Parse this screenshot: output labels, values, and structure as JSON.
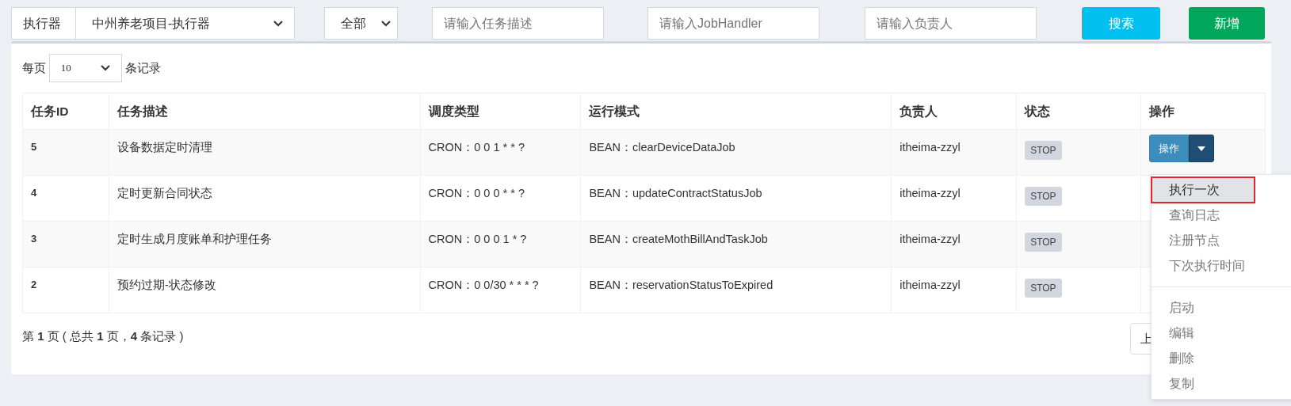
{
  "filters": {
    "executor_label": "执行器",
    "executor_value": "中州养老项目-执行器",
    "status_value": "全部",
    "desc_placeholder": "请输入任务描述",
    "handler_placeholder": "请输入JobHandler",
    "author_placeholder": "请输入负责人",
    "search_button": "搜索",
    "add_button": "新增"
  },
  "page_size": {
    "before": "每页",
    "value": "10",
    "after": "条记录"
  },
  "table": {
    "columns": [
      "任务ID",
      "任务描述",
      "调度类型",
      "运行模式",
      "负责人",
      "状态",
      "操作"
    ],
    "rows": [
      {
        "id": "5",
        "desc": "设备数据定时清理",
        "schedule": "CRON：0 0 1 * * ?",
        "mode": "BEAN：clearDeviceDataJob",
        "author": "itheima-zzyl",
        "status": "STOP",
        "action": "操作"
      },
      {
        "id": "4",
        "desc": "定时更新合同状态",
        "schedule": "CRON：0 0 0 * * ?",
        "mode": "BEAN：updateContractStatusJob",
        "author": "itheima-zzyl",
        "status": "STOP"
      },
      {
        "id": "3",
        "desc": "定时生成月度账单和护理任务",
        "schedule": "CRON：0 0 0 1 * ?",
        "mode": "BEAN：createMothBillAndTaskJob",
        "author": "itheima-zzyl",
        "status": "STOP"
      },
      {
        "id": "2",
        "desc": "预约过期-状态修改",
        "schedule": "CRON：0 0/30 * * * ?",
        "mode": "BEAN：reservationStatusToExpired",
        "author": "itheima-zzyl",
        "status": "STOP"
      }
    ]
  },
  "footer": "第 **1** 页 ( 总共 **1** 页，**4** 条记录 )",
  "pager_button": "上",
  "action_menu": [
    {
      "kind": "item",
      "label": "执行一次",
      "highlighted": true
    },
    {
      "kind": "item",
      "label": "查询日志",
      "highlighted": false
    },
    {
      "kind": "item",
      "label": "注册节点",
      "highlighted": false
    },
    {
      "kind": "item",
      "label": "下次执行时间",
      "highlighted": false
    },
    {
      "kind": "divider"
    },
    {
      "kind": "item",
      "label": "启动",
      "highlighted": false
    },
    {
      "kind": "item",
      "label": "编辑",
      "highlighted": false
    },
    {
      "kind": "item",
      "label": "删除",
      "highlighted": false
    },
    {
      "kind": "item",
      "label": "复制",
      "highlighted": false
    }
  ]
}
